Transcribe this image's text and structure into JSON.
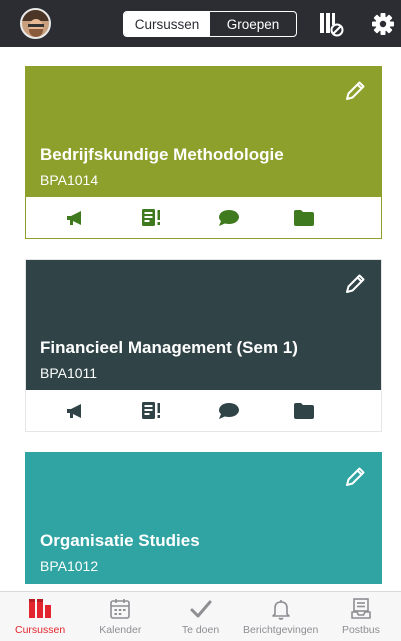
{
  "header": {
    "segments": [
      {
        "label": "Cursussen",
        "active": true
      },
      {
        "label": "Groepen",
        "active": false
      }
    ],
    "icons": [
      "avatar",
      "filter-off-icon",
      "gear-icon"
    ]
  },
  "courses": [
    {
      "title": "Bedrijfskundige Methodologie",
      "code": "BPA1014",
      "color": "#8da02c"
    },
    {
      "title": "Financieel Management (Sem 1)",
      "code": "BPA1011",
      "color": "#304347"
    },
    {
      "title": "Organisatie Studies",
      "code": "BPA1012",
      "color": "#30a3a3"
    }
  ],
  "card_actions": [
    "megaphone-icon",
    "assignment-icon",
    "chat-bubble-icon",
    "folder-icon"
  ],
  "colors": {
    "topbar": "#2b2d33",
    "accent_red": "#e3262e",
    "icon_green": "#3f7a1e",
    "inactive_gray": "#8e8e93"
  },
  "tabbar": {
    "tabs": [
      {
        "label": "Cursussen",
        "icon": "courses-icon",
        "active": true
      },
      {
        "label": "Kalender",
        "icon": "calendar-icon",
        "active": false
      },
      {
        "label": "Te doen",
        "icon": "checkmark-icon",
        "active": false
      },
      {
        "label": "Berichtgevingen",
        "icon": "bell-icon",
        "active": false
      },
      {
        "label": "Postbus",
        "icon": "inbox-icon",
        "active": false
      }
    ]
  }
}
